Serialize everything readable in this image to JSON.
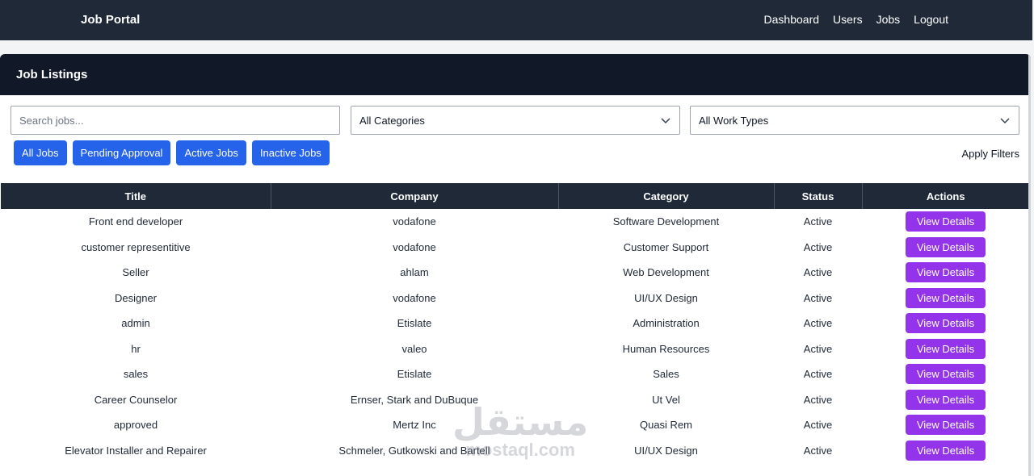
{
  "navbar": {
    "brand": "Job Portal",
    "links": [
      "Dashboard",
      "Users",
      "Jobs",
      "Logout"
    ]
  },
  "card": {
    "title": "Job Listings"
  },
  "filters": {
    "search_placeholder": "Search jobs...",
    "category_selected": "All Categories",
    "work_type_selected": "All Work Types",
    "buttons": [
      "All Jobs",
      "Pending Approval",
      "Active Jobs",
      "Inactive Jobs"
    ],
    "apply_label": "Apply Filters"
  },
  "table": {
    "headers": [
      "Title",
      "Company",
      "Category",
      "Status",
      "Actions"
    ],
    "action_label": "View Details",
    "rows": [
      {
        "title": "Front end developer",
        "company": "vodafone",
        "category": "Software Development",
        "status": "Active"
      },
      {
        "title": "customer representitive",
        "company": "vodafone",
        "category": "Customer Support",
        "status": "Active"
      },
      {
        "title": "Seller",
        "company": "ahlam",
        "category": "Web Development",
        "status": "Active"
      },
      {
        "title": "Designer",
        "company": "vodafone",
        "category": "UI/UX Design",
        "status": "Active"
      },
      {
        "title": "admin",
        "company": "Etislate",
        "category": "Administration",
        "status": "Active"
      },
      {
        "title": "hr",
        "company": "valeo",
        "category": "Human Resources",
        "status": "Active"
      },
      {
        "title": "sales",
        "company": "Etislate",
        "category": "Sales",
        "status": "Active"
      },
      {
        "title": "Career Counselor",
        "company": "Ernser, Stark and DuBuque",
        "category": "Ut Vel",
        "status": "Active"
      },
      {
        "title": "approved",
        "company": "Mertz Inc",
        "category": "Quasi Rem",
        "status": "Active"
      },
      {
        "title": "Elevator Installer and Repairer",
        "company": "Schmeler, Gutkowski and Bartell",
        "category": "UI/UX Design",
        "status": "Active"
      }
    ]
  },
  "watermark": {
    "logo": "مستقل",
    "url": "mostaql.com"
  },
  "colors": {
    "navbar": "#1f2937",
    "card_header": "#111827",
    "filter_button": "#2563eb",
    "view_button": "#9333ea"
  }
}
